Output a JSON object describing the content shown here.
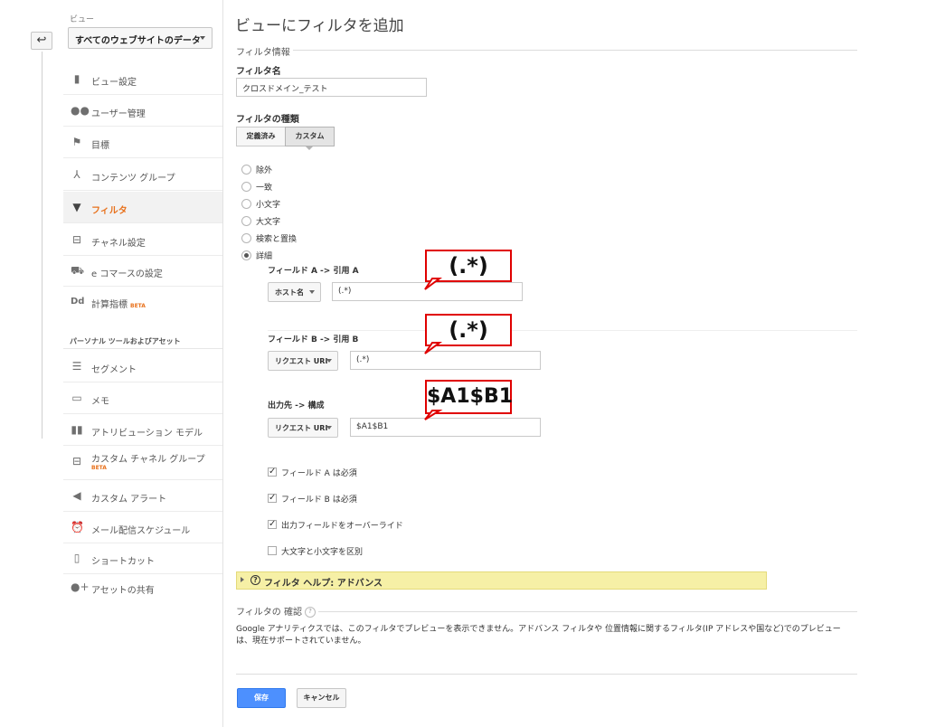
{
  "sidebar": {
    "view_label": "ビュー",
    "view_select": "すべてのウェブサイトのデータ",
    "items": [
      {
        "label": "ビュー設定"
      },
      {
        "label": "ユーザー管理"
      },
      {
        "label": "目標"
      },
      {
        "label": "コンテンツ グループ"
      },
      {
        "label": "フィルタ"
      },
      {
        "label": "チャネル設定"
      },
      {
        "label": "e コマースの設定"
      },
      {
        "label": "計算指標",
        "badge": "BETA"
      }
    ],
    "section_heading": "パーソナル ツールおよびアセット",
    "tools": [
      {
        "label": "セグメント"
      },
      {
        "label": "メモ"
      },
      {
        "label": "アトリビューション モデル"
      },
      {
        "label": "カスタム チャネル グループ",
        "badge": "BETA"
      },
      {
        "label": "カスタム アラート"
      },
      {
        "label": "メール配信スケジュール"
      },
      {
        "label": "ショートカット"
      },
      {
        "label": "アセットの共有"
      }
    ]
  },
  "main": {
    "title": "ビューにフィルタを追加",
    "filter_info": "フィルタ情報",
    "filter_name_label": "フィルタ名",
    "filter_name_value": "クロスドメイン_テスト",
    "filter_type_label": "フィルタの種類",
    "type_tabs": [
      "定義済み",
      "カスタム"
    ],
    "radios": [
      "除外",
      "一致",
      "小文字",
      "大文字",
      "検索と置換",
      "詳細"
    ],
    "field_a": {
      "label": "フィールド A -> 引用 A",
      "dropdown": "ホスト名",
      "value": "(.*)"
    },
    "field_b": {
      "label": "フィールド B -> 引用 B",
      "dropdown": "リクエスト URI",
      "value": "(.*)"
    },
    "output": {
      "label": "出力先 -> 構成",
      "dropdown": "リクエスト URI",
      "value": "$A1$B1"
    },
    "checkboxes": [
      {
        "label": "フィールド A は必須",
        "checked": true
      },
      {
        "label": "フィールド B は必須",
        "checked": true
      },
      {
        "label": "出力フィールドをオーバーライド",
        "checked": true
      },
      {
        "label": "大文字と小文字を区別",
        "checked": false
      }
    ],
    "help_bar": "フィルタ ヘルプ: アドバンス",
    "verify_heading": "フィルタの 確認",
    "verify_text": "Google アナリティクスでは、このフィルタでプレビューを表示できません。アドバンス フィルタや 位置情報に関するフィルタ(IP アドレスや国など)でのプレビューは、現在サポートされていません。",
    "save": "保存",
    "cancel": "キャンセル"
  },
  "callouts": [
    "(.*)",
    "(.*)",
    "$A1$B1"
  ]
}
